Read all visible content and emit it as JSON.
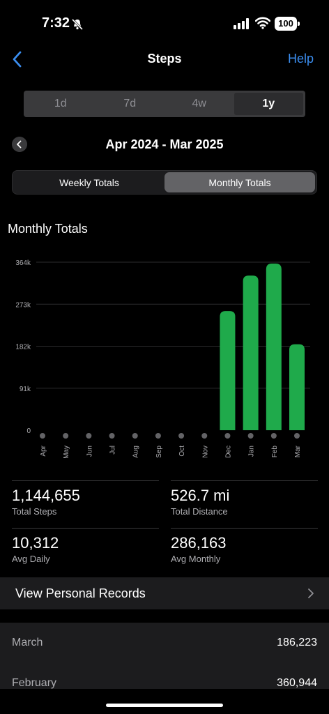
{
  "status": {
    "time": "7:32",
    "battery": "100"
  },
  "nav": {
    "title": "Steps",
    "help": "Help"
  },
  "range_tabs": [
    {
      "label": "1d",
      "selected": false
    },
    {
      "label": "7d",
      "selected": false
    },
    {
      "label": "4w",
      "selected": false
    },
    {
      "label": "1y",
      "selected": true
    }
  ],
  "period": {
    "label": "Apr 2024 - Mar 2025"
  },
  "totals_tabs": [
    {
      "label": "Weekly Totals",
      "selected": false
    },
    {
      "label": "Monthly Totals",
      "selected": true
    }
  ],
  "chart_title": "Monthly Totals",
  "chart_data": {
    "type": "bar",
    "title": "Monthly Totals",
    "categories": [
      "Apr",
      "May",
      "Jun",
      "Jul",
      "Aug",
      "Sep",
      "Oct",
      "Nov",
      "Dec",
      "Jan",
      "Feb",
      "Mar"
    ],
    "values": [
      0,
      0,
      0,
      0,
      0,
      0,
      0,
      0,
      258000,
      335000,
      360944,
      186223
    ],
    "yticks": [
      "0",
      "91k",
      "182k",
      "273k",
      "364k"
    ],
    "ytick_values": [
      0,
      91000,
      182000,
      273000,
      364000
    ],
    "ylim": [
      0,
      364000
    ],
    "grid": true,
    "bar_color": "#1faa4b",
    "zero_marker_color": "#636366"
  },
  "stats": [
    {
      "value": "1,144,655",
      "label": "Total Steps"
    },
    {
      "value": "526.7 mi",
      "label": "Total Distance"
    },
    {
      "value": "10,312",
      "label": "Avg Daily"
    },
    {
      "value": "286,163",
      "label": "Avg Monthly"
    }
  ],
  "records": {
    "label": "View Personal Records"
  },
  "month_list": [
    {
      "month": "March",
      "value": "186,223"
    },
    {
      "month": "February",
      "value": "360,944"
    }
  ],
  "colors": {
    "accent": "#3b8ef0",
    "bar": "#1faa4b"
  }
}
